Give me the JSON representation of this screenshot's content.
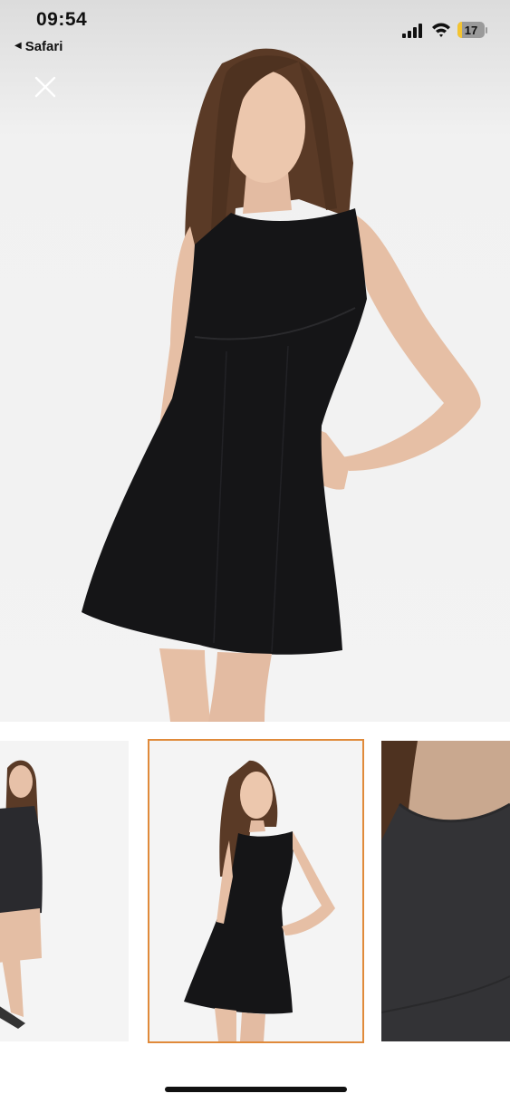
{
  "status_bar": {
    "time": "09:54",
    "back_app": "Safari",
    "battery_level": "17",
    "icons": [
      "cellular-signal-icon",
      "wifi-icon",
      "battery-icon"
    ]
  },
  "viewer": {
    "close_icon": "close-icon",
    "main_image": "woman wearing black sleeveless fit-and-flare mini dress",
    "thumbnails": [
      {
        "name": "thumbnail-side-view",
        "selected": false
      },
      {
        "name": "thumbnail-front-view",
        "selected": true
      },
      {
        "name": "thumbnail-neckline-closeup",
        "selected": false
      }
    ],
    "selected_border_color": "#e08a3a"
  }
}
